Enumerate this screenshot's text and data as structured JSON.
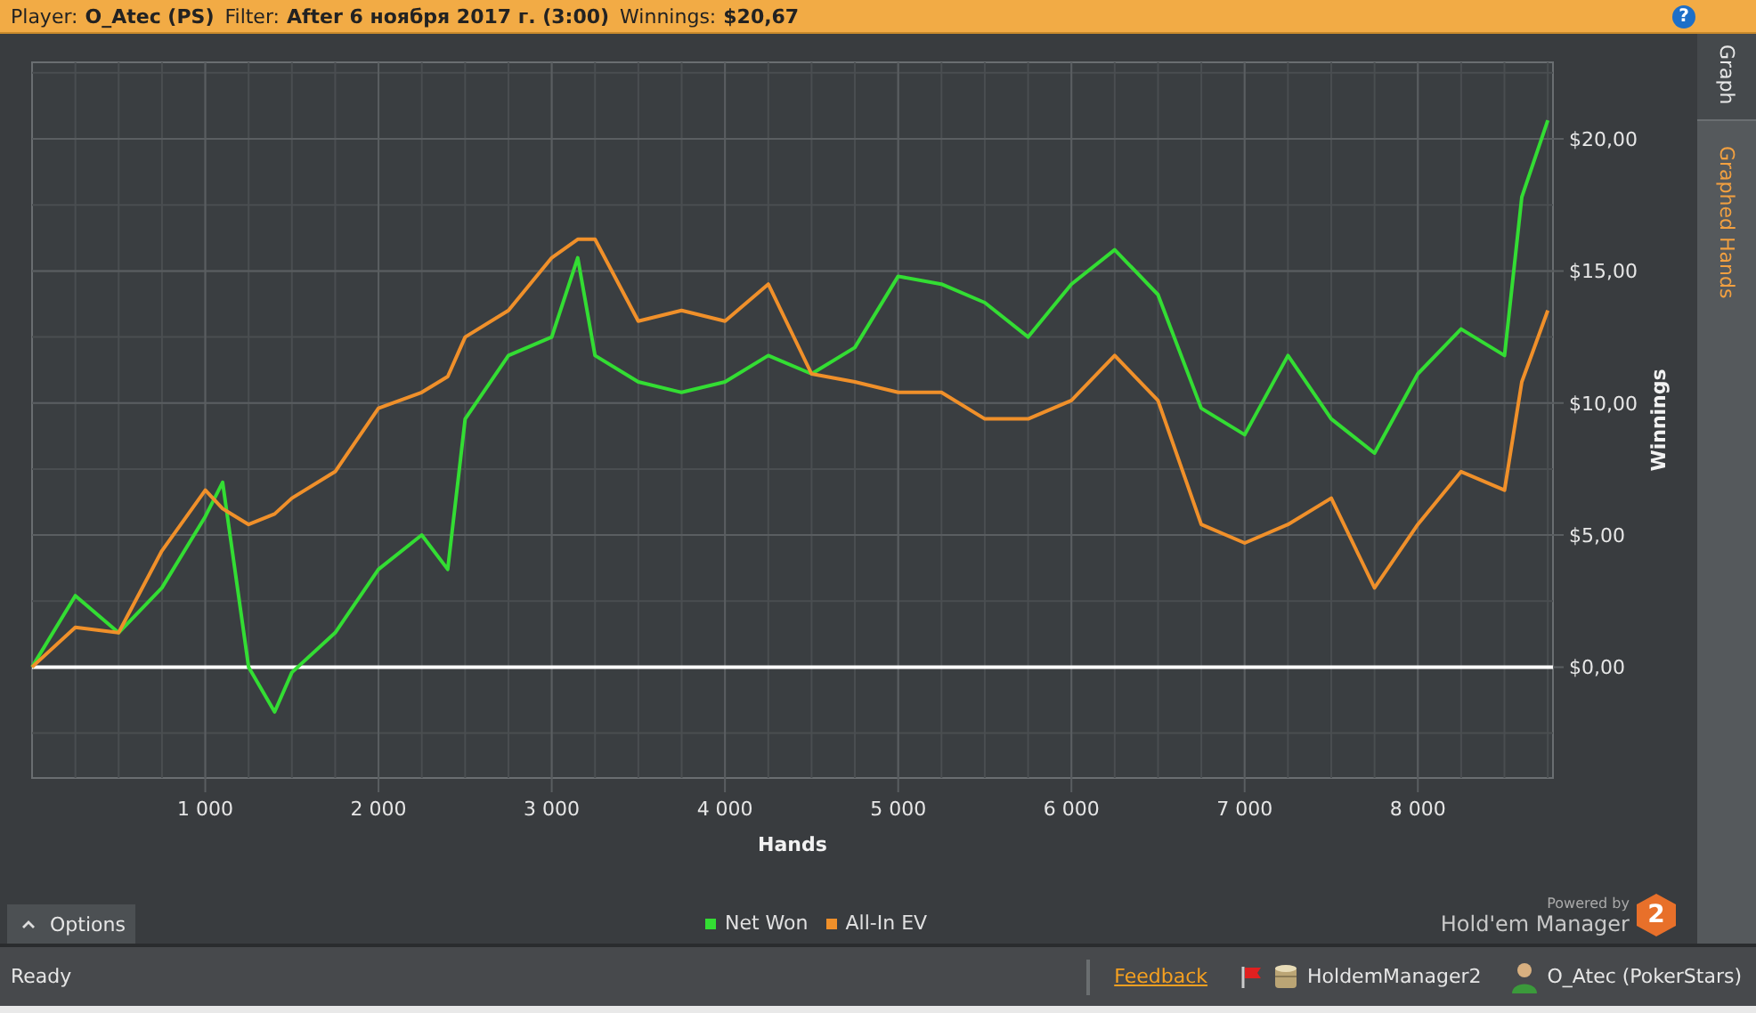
{
  "header": {
    "fields": [
      {
        "label": "Player:",
        "value": "O_Atec (PS)"
      },
      {
        "label": "Filter:",
        "value": "After 6 ноября 2017 г. (3:00)"
      },
      {
        "label": "Winnings:",
        "value": "$20,67"
      }
    ],
    "help": "?"
  },
  "side_tabs": [
    {
      "label": "Graph",
      "selected": true
    },
    {
      "label": "Graphed Hands",
      "selected": false
    }
  ],
  "chart": {
    "chart_data": {
      "type": "line",
      "xlabel": "Hands",
      "ylabel": "Winnings",
      "x": [
        0,
        250,
        500,
        750,
        1000,
        1100,
        1250,
        1400,
        1500,
        1750,
        2000,
        2250,
        2400,
        2500,
        2750,
        3000,
        3150,
        3250,
        3500,
        3750,
        4000,
        4250,
        4500,
        4750,
        5000,
        5250,
        5500,
        5750,
        6000,
        6250,
        6500,
        6750,
        7000,
        7250,
        7500,
        7750,
        8000,
        8250,
        8500,
        8600,
        8750
      ],
      "series": [
        {
          "name": "Net Won",
          "color": "#33dd33",
          "values": [
            0,
            2.7,
            1.3,
            3.0,
            5.7,
            7.0,
            0,
            -1.7,
            -0.2,
            1.3,
            3.7,
            5.0,
            3.7,
            9.4,
            11.8,
            12.5,
            15.5,
            11.8,
            10.8,
            10.4,
            10.8,
            11.8,
            11.1,
            12.1,
            14.8,
            14.5,
            13.8,
            12.5,
            14.5,
            15.8,
            14.1,
            9.8,
            8.8,
            11.8,
            9.4,
            8.1,
            11.1,
            12.8,
            11.8,
            17.8,
            20.7
          ]
        },
        {
          "name": "All-In EV",
          "color": "#f0902a",
          "values": [
            0,
            1.5,
            1.3,
            4.4,
            6.7,
            6.0,
            5.4,
            5.8,
            6.4,
            7.4,
            9.8,
            10.4,
            11.0,
            12.5,
            13.5,
            15.5,
            16.2,
            16.2,
            13.1,
            13.5,
            13.1,
            14.5,
            11.1,
            10.8,
            10.4,
            10.4,
            9.4,
            9.4,
            10.1,
            11.8,
            10.1,
            5.4,
            4.7,
            5.4,
            6.4,
            3.0,
            5.4,
            7.4,
            6.7,
            10.8,
            13.5
          ]
        }
      ],
      "grid": true,
      "xlim": [
        0,
        8780
      ],
      "ylim": [
        -4.2,
        22.9
      ],
      "xticks": [
        {
          "value": 1000,
          "label": "1 000"
        },
        {
          "value": 2000,
          "label": "2 000"
        },
        {
          "value": 3000,
          "label": "3 000"
        },
        {
          "value": 4000,
          "label": "4 000"
        },
        {
          "value": 5000,
          "label": "5 000"
        },
        {
          "value": 6000,
          "label": "6 000"
        },
        {
          "value": 7000,
          "label": "7 000"
        },
        {
          "value": 8000,
          "label": "8 000"
        }
      ],
      "yticks": [
        {
          "value": 0,
          "label": "$0,00"
        },
        {
          "value": 5,
          "label": "$5,00"
        },
        {
          "value": 10,
          "label": "$10,00"
        },
        {
          "value": 15,
          "label": "$15,00"
        },
        {
          "value": 20,
          "label": "$20,00"
        }
      ]
    }
  },
  "options_button": "Options",
  "powered": {
    "caption": "Powered by",
    "name": "Hold'em Manager",
    "badge": "2"
  },
  "status_bar": {
    "status": "Ready",
    "link": "Feedback",
    "database": "HoldemManager2",
    "player": "O_Atec (PokerStars)"
  }
}
